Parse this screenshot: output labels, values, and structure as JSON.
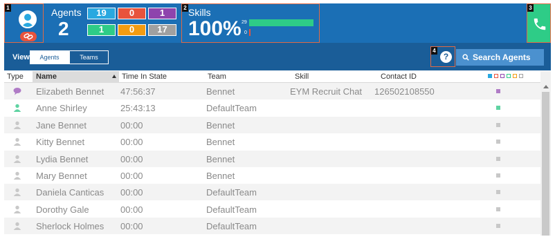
{
  "agents": {
    "label": "Agents",
    "count": "2",
    "stats": [
      {
        "value": "19",
        "color": "#29a8e0"
      },
      {
        "value": "0",
        "color": "#e8533c"
      },
      {
        "value": "1",
        "color": "#8e44ad"
      },
      {
        "value": "1",
        "color": "#2ecc87"
      },
      {
        "value": "0",
        "color": "#f39c12"
      },
      {
        "value": "17",
        "color": "#a0a0a0"
      }
    ]
  },
  "skills": {
    "label": "Skills",
    "percent": "100%",
    "bars": [
      {
        "label": "29",
        "fraction": 1.0
      },
      {
        "label": "0",
        "fraction": 0.0
      }
    ]
  },
  "callouts": [
    "1",
    "2",
    "3",
    "4"
  ],
  "toolbar": {
    "view_label": "View",
    "tabs": [
      {
        "label": "Agents",
        "active": true
      },
      {
        "label": "Teams",
        "active": false
      }
    ],
    "help_label": "?",
    "search_label": "Search Agents"
  },
  "table": {
    "headers": {
      "type": "Type",
      "name": "Name",
      "time": "Time In State",
      "team": "Team",
      "skill": "Skill",
      "contact": "Contact ID"
    },
    "legend_colors": [
      "#29a8e0",
      "#e8533c",
      "#8e44ad",
      "#2ecc87",
      "#f39c12",
      "#a0a0a0"
    ],
    "rows": [
      {
        "type_icon": "chat-icon",
        "icon_color": "#b07cc6",
        "name": "Elizabeth Bennet",
        "time": "47:56:37",
        "team": "Bennet",
        "skill": "EYM Recruit Chat",
        "contact": "126502108550",
        "status_color": "#b07cc6"
      },
      {
        "type_icon": "person-icon",
        "icon_color": "#5fd3a2",
        "name": "Anne Shirley",
        "time": "25:43:13",
        "team": "DefaultTeam",
        "skill": "",
        "contact": "",
        "status_color": "#5fd3a2"
      },
      {
        "type_icon": "person-icon",
        "icon_color": "#c8c8c8",
        "name": "Jane Bennet",
        "time": "00:00",
        "team": "Bennet",
        "skill": "",
        "contact": "",
        "status_color": "#c8c8c8"
      },
      {
        "type_icon": "person-icon",
        "icon_color": "#c8c8c8",
        "name": "Kitty Bennet",
        "time": "00:00",
        "team": "Bennet",
        "skill": "",
        "contact": "",
        "status_color": "#c8c8c8"
      },
      {
        "type_icon": "person-icon",
        "icon_color": "#c8c8c8",
        "name": "Lydia Bennet",
        "time": "00:00",
        "team": "Bennet",
        "skill": "",
        "contact": "",
        "status_color": "#c8c8c8"
      },
      {
        "type_icon": "person-icon",
        "icon_color": "#c8c8c8",
        "name": "Mary Bennet",
        "time": "00:00",
        "team": "Bennet",
        "skill": "",
        "contact": "",
        "status_color": "#c8c8c8"
      },
      {
        "type_icon": "person-icon",
        "icon_color": "#c8c8c8",
        "name": "Daniela Canticas",
        "time": "00:00",
        "team": "DefaultTeam",
        "skill": "",
        "contact": "",
        "status_color": "#c8c8c8"
      },
      {
        "type_icon": "person-icon",
        "icon_color": "#c8c8c8",
        "name": "Dorothy Gale",
        "time": "00:00",
        "team": "DefaultTeam",
        "skill": "",
        "contact": "",
        "status_color": "#c8c8c8"
      },
      {
        "type_icon": "person-icon",
        "icon_color": "#c8c8c8",
        "name": "Sherlock Holmes",
        "time": "00:00",
        "team": "DefaultTeam",
        "skill": "",
        "contact": "",
        "status_color": "#c8c8c8"
      }
    ]
  }
}
